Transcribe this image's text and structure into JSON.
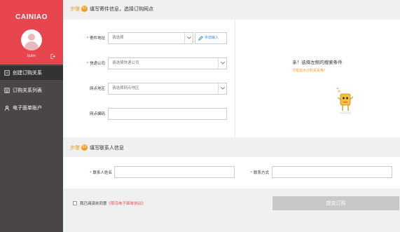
{
  "sidebar": {
    "logo": "CAINIAO",
    "username": "ljulin",
    "items": [
      {
        "label": "创建订购关系",
        "icon": "link-icon",
        "active": true
      },
      {
        "label": "订购关系列表",
        "icon": "list-icon",
        "active": false
      },
      {
        "label": "电子面单账户",
        "icon": "user-icon",
        "active": false
      }
    ]
  },
  "colors": {
    "brand": "#e8464f",
    "accent": "#f29a1b",
    "sidebar": "#4a4648",
    "link": "#3a86d1"
  },
  "section1": {
    "step_word": "步骤",
    "step_num": "01",
    "title": "填写寄件信息，选择订购网点",
    "fields": {
      "sender_address": {
        "label": "寄件地址",
        "placeholder": "请选择"
      },
      "manual_input": "手动输入",
      "courier": {
        "label": "快递公司",
        "placeholder": "请选择快递公司"
      },
      "branch_area": {
        "label": "网点地区",
        "placeholder": "请选择网点地区"
      },
      "branch_code": {
        "label": "网点编码",
        "value": ""
      }
    },
    "empty_state": {
      "title": "亲！选择左侧的搜索条件",
      "subtitle": "才能显示订购关系哦！"
    }
  },
  "section2": {
    "step_word": "步骤",
    "step_num": "02",
    "title": "填写联系人信息",
    "fields": {
      "contact_name": {
        "label": "联系人姓名",
        "value": ""
      },
      "contact_method": {
        "label": "联系方式",
        "value": ""
      }
    }
  },
  "agreement": {
    "prefix": "我已阅读并同意",
    "link": "《菜鸟电子面单协议》",
    "checked": false
  },
  "submit": {
    "label": "提交订购"
  }
}
